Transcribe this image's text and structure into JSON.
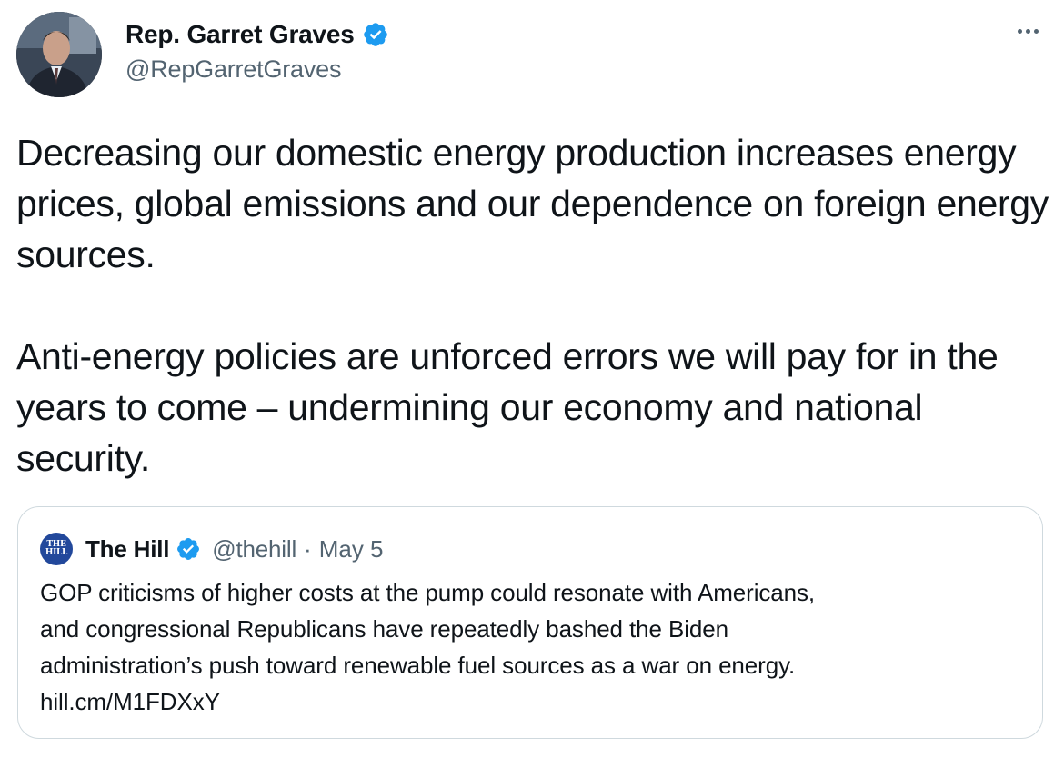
{
  "tweet": {
    "author": {
      "name": "Rep. Garret Graves",
      "handle": "@RepGarretGraves",
      "verified": true
    },
    "more_menu_icon": "more-horizontal-icon",
    "body_paragraphs": [
      "Decreasing our domestic energy production increases energy prices, global emissions and our dependence on foreign energy sources.",
      "Anti-energy policies are unforced errors we will pay for in the years to come – undermining our economy and national security."
    ]
  },
  "quoted_tweet": {
    "author": {
      "name": "The Hill",
      "handle": "@thehill",
      "verified": true,
      "avatar_text": [
        "THE",
        "HILL"
      ]
    },
    "separator": "·",
    "date": "May 5",
    "lines": [
      "GOP criticisms of higher costs at the pump could resonate with Americans,",
      "and congressional Republicans have repeatedly bashed the Biden",
      "administration’s push toward renewable fuel sources as a war on energy.",
      "hill.cm/M1FDXxY"
    ]
  },
  "colors": {
    "verified_blue": "#1d9bf0",
    "secondary_text": "#536471",
    "primary_text": "#0f1419",
    "border": "#cfd9de",
    "hill_avatar": "#22489b"
  }
}
